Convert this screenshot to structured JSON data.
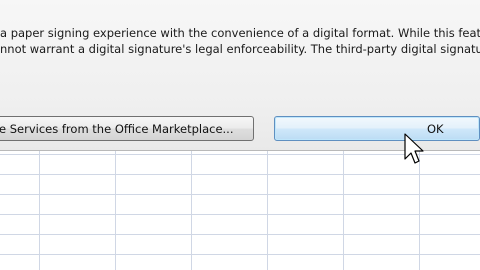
{
  "dialog": {
    "message_lines": [
      "a paper signing experience with the convenience of a digital format. While this feat",
      "nnot warrant a digital signature's legal enforceability. The third-party digital signatu"
    ],
    "services_button_label": "e Services from the Office Marketplace...",
    "ok_button_label": "OK"
  },
  "icons": {
    "cursor": "arrow-pointer-icon"
  }
}
